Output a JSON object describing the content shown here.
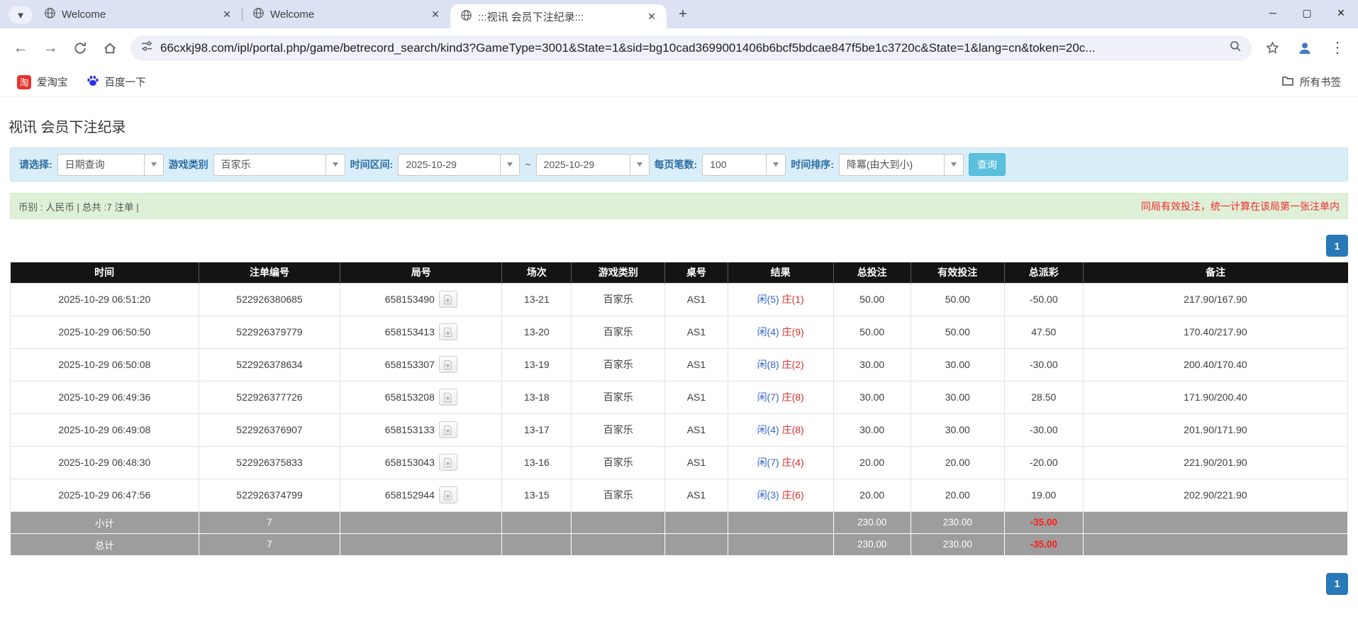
{
  "browser": {
    "tabs": [
      {
        "title": "Welcome"
      },
      {
        "title": "Welcome"
      },
      {
        "title": ":::视讯 会员下注纪录:::"
      }
    ],
    "url": "66cxkj98.com/ipl/portal.php/game/betrecord_search/kind3?GameType=3001&State=1&sid=bg10cad3699001406b6bcf5bdcae847f5be1c3720c&State=1&lang=cn&token=20c...",
    "bookmarks": [
      {
        "label": "爱淘宝",
        "badge_glyph": "淘"
      },
      {
        "label": "百度一下"
      }
    ],
    "all_bookmarks_label": "所有书签"
  },
  "page": {
    "title": "视讯 会员下注纪录",
    "filters": {
      "select_label": "请选择:",
      "select_value": "日期查询",
      "game_type_label": "游戏类别",
      "game_type_value": "百家乐",
      "date_range_label": "时间区间:",
      "date_from": "2025-10-29",
      "tilde": "~",
      "date_to": "2025-10-29",
      "page_size_label": "每页笔数:",
      "page_size_value": "100",
      "sort_label": "时间排序:",
      "sort_value": "降冪(由大到小)",
      "search_button": "查询"
    },
    "summary_bar": {
      "left": "币别 : 人民币 | 总共 :7 注单 |",
      "right": "同局有效投注，统一计算在该局第一张注单内"
    },
    "pagination": {
      "page": "1"
    },
    "table": {
      "headers": [
        "时间",
        "注单编号",
        "局号",
        "场次",
        "游戏类别",
        "桌号",
        "结果",
        "总投注",
        "有效投注",
        "总派彩",
        "备注"
      ],
      "rows": [
        {
          "time": "2025-10-29 06:51:20",
          "bet_id": "522926380685",
          "round_id": "658153490",
          "session": "13-21",
          "game": "百家乐",
          "table_no": "AS1",
          "result_player": "闲(5)",
          "result_banker": "庄(1)",
          "total_bet": "50.00",
          "valid_bet": "50.00",
          "payout": "-50.00",
          "remark": "217.90/167.90"
        },
        {
          "time": "2025-10-29 06:50:50",
          "bet_id": "522926379779",
          "round_id": "658153413",
          "session": "13-20",
          "game": "百家乐",
          "table_no": "AS1",
          "result_player": "闲(4)",
          "result_banker": "庄(9)",
          "total_bet": "50.00",
          "valid_bet": "50.00",
          "payout": "47.50",
          "remark": "170.40/217.90"
        },
        {
          "time": "2025-10-29 06:50:08",
          "bet_id": "522926378634",
          "round_id": "658153307",
          "session": "13-19",
          "game": "百家乐",
          "table_no": "AS1",
          "result_player": "闲(8)",
          "result_banker": "庄(2)",
          "total_bet": "30.00",
          "valid_bet": "30.00",
          "payout": "-30.00",
          "remark": "200.40/170.40"
        },
        {
          "time": "2025-10-29 06:49:36",
          "bet_id": "522926377726",
          "round_id": "658153208",
          "session": "13-18",
          "game": "百家乐",
          "table_no": "AS1",
          "result_player": "闲(7)",
          "result_banker": "庄(8)",
          "total_bet": "30.00",
          "valid_bet": "30.00",
          "payout": "28.50",
          "remark": "171.90/200.40"
        },
        {
          "time": "2025-10-29 06:49:08",
          "bet_id": "522926376907",
          "round_id": "658153133",
          "session": "13-17",
          "game": "百家乐",
          "table_no": "AS1",
          "result_player": "闲(4)",
          "result_banker": "庄(8)",
          "total_bet": "30.00",
          "valid_bet": "30.00",
          "payout": "-30.00",
          "remark": "201.90/171.90"
        },
        {
          "time": "2025-10-29 06:48:30",
          "bet_id": "522926375833",
          "round_id": "658153043",
          "session": "13-16",
          "game": "百家乐",
          "table_no": "AS1",
          "result_player": "闲(7)",
          "result_banker": "庄(4)",
          "total_bet": "20.00",
          "valid_bet": "20.00",
          "payout": "-20.00",
          "remark": "221.90/201.90"
        },
        {
          "time": "2025-10-29 06:47:56",
          "bet_id": "522926374799",
          "round_id": "658152944",
          "session": "13-15",
          "game": "百家乐",
          "table_no": "AS1",
          "result_player": "闲(3)",
          "result_banker": "庄(6)",
          "total_bet": "20.00",
          "valid_bet": "20.00",
          "payout": "19.00",
          "remark": "202.90/221.90"
        }
      ],
      "summary_rows": [
        {
          "label": "小计",
          "count": "7",
          "total_bet": "230.00",
          "valid_bet": "230.00",
          "payout": "-35.00"
        },
        {
          "label": "总计",
          "count": "7",
          "total_bet": "230.00",
          "valid_bet": "230.00",
          "payout": "-35.00"
        }
      ]
    }
  },
  "colors": {
    "accent_blue": "#2779b7",
    "link_blue": "#3c78d9",
    "player_blue": "#3366cc",
    "banker_red": "#d9302c",
    "negative_red": "#ee0000",
    "header_bg": "#141414",
    "summary_row_bg": "#9d9d9d",
    "filter_bar_bg": "#d9eef8",
    "summary_bar_bg": "#dff0d8"
  }
}
